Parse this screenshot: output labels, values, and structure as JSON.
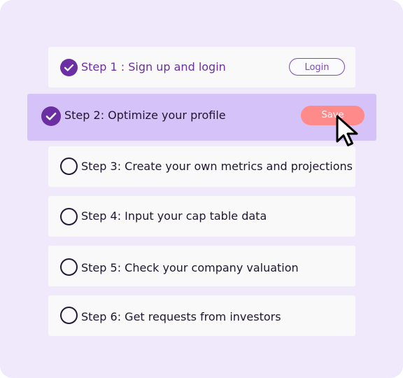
{
  "steps": [
    {
      "label": "Step 1 : Sign up and login",
      "status": "done",
      "button": "Login"
    },
    {
      "label": "Step 2: Optimize your profile",
      "status": "done",
      "button": "Save",
      "active": true
    },
    {
      "label": "Step 3: Create your own metrics and projections",
      "status": "todo"
    },
    {
      "label": "Step 4: Input your cap table data",
      "status": "todo"
    },
    {
      "label": "Step 5: Check your company valuation",
      "status": "todo"
    },
    {
      "label": "Step 6: Get requests from investors",
      "status": "todo"
    }
  ],
  "colors": {
    "background": "#efe9fb",
    "card": "#f9f9f9",
    "active_card": "#d5c2f8",
    "check_done": "#6b2fa3",
    "save_button": "#ff8a8a",
    "login_border": "#7a4bb6"
  },
  "icons": {
    "done": "checkmark-circle-icon",
    "todo": "empty-circle-icon",
    "pointer": "mouse-cursor-icon"
  }
}
